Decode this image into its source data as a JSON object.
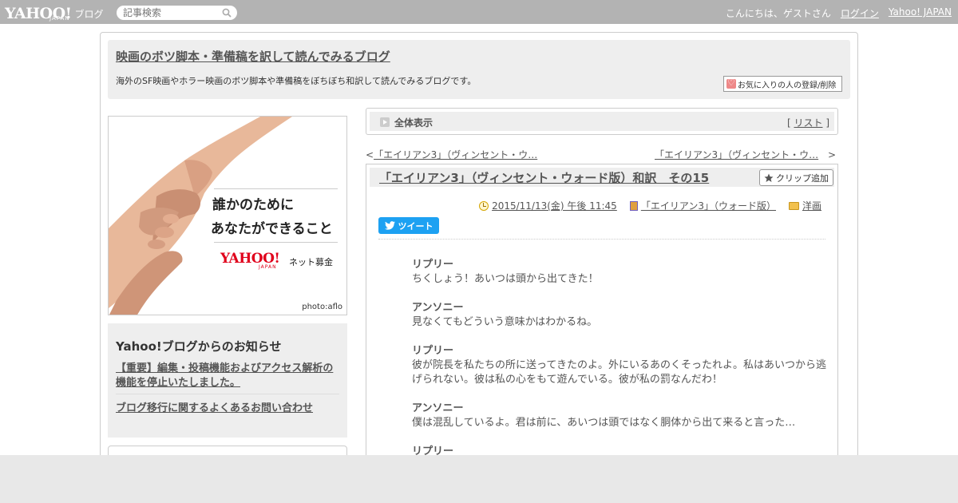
{
  "topbar": {
    "logo_word": "YAHOO!",
    "logo_sub": "JAPAN",
    "logo_blog": "ブログ",
    "search_placeholder": "記事検索",
    "greeting": "こんにちは、ゲストさん",
    "login": "ログイン",
    "yahoo_japan": "Yahoo! JAPAN"
  },
  "header": {
    "title": "映画のボツ脚本・準備稿を訳して読んでみるブログ",
    "description": "海外のSF映画やホラー映画のボツ脚本や準備稿をぼちぼち和訳して読んでみるブログです。",
    "fav_button": "お気に入りの人の登録/削除"
  },
  "banner": {
    "line1": "誰かのために",
    "line2": "あなたができること",
    "yahoo_word": "YAHOO!",
    "yahoo_sub": "JAPAN",
    "service": "ネット募金",
    "credit": "photo:aflo"
  },
  "notice": {
    "title": "Yahoo!ブログからのお知らせ",
    "link1": "【重要】編集・投稿機能およびアクセス解析の機能を停止いたしました。",
    "link2": "ブログ移行に関するよくあるお問い合わせ"
  },
  "listbar": {
    "label": "全体表示",
    "bracket_open": "[",
    "list_link": "リスト",
    "bracket_close": "]"
  },
  "nav": {
    "prev_arrow": "<",
    "prev_link": "「エイリアン3」（ヴィンセント・ウ…",
    "next_link": "「エイリアン3」（ヴィンセント・ウ…",
    "next_arrow": ">"
  },
  "article": {
    "title": "「エイリアン3」（ヴィンセント・ウォード版）和訳　その15",
    "clip_button": "クリップ追加",
    "date": "2015/11/13(金) 午後 11:45",
    "category": "「エイリアン3」（ウォード版）",
    "genre": "洋画",
    "tweet": "ツイート",
    "dialogue": [
      {
        "speaker": "リプリー",
        "line": "ちくしょう！あいつは頭から出てきた！"
      },
      {
        "speaker": "アンソニー",
        "line": "見なくてもどういう意味かはわかるね。"
      },
      {
        "speaker": "リプリー",
        "line": "彼が院長を私たちの所に送ってきたのよ。外にいるあのくそったれよ。私はあいつから逃げられない。彼は私の心をもて遊んでいる。彼が私の罰なんだわ！"
      },
      {
        "speaker": "アンソニー",
        "line": "僕は混乱しているよ。君は前に、あいつは頭ではなく胴体から出て来ると言った…"
      },
      {
        "speaker": "リプリー",
        "line": ""
      }
    ]
  },
  "colors": {
    "topbar": "#b3b3b3",
    "tweet": "#1da1f2",
    "banner_red": "#e0001b"
  }
}
